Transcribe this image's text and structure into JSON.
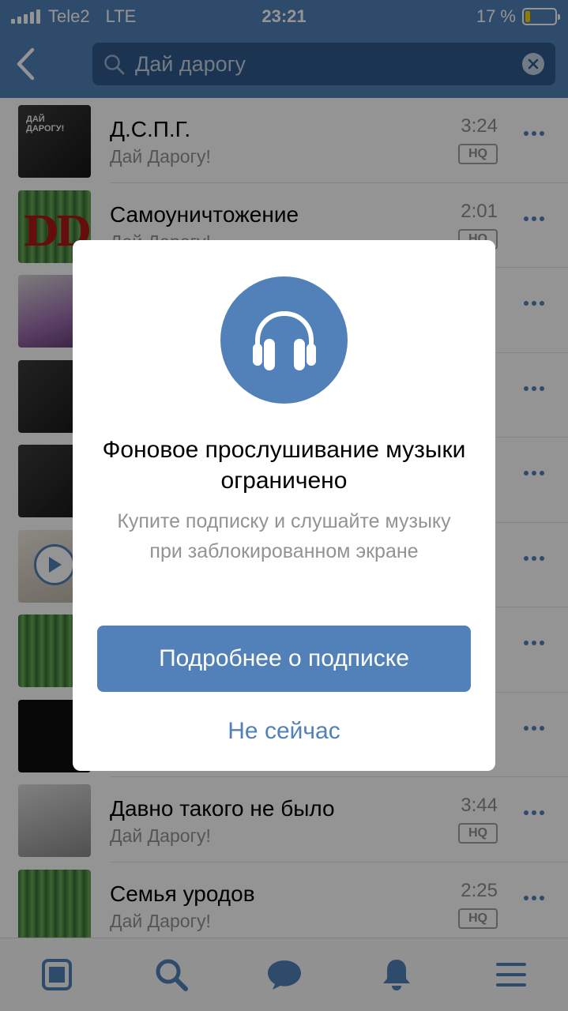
{
  "status_bar": {
    "carrier": "Tele2",
    "network": "LTE",
    "time": "23:21",
    "battery": "17 %",
    "battery_level_percent": 17
  },
  "header": {
    "back_icon": "chevron-left-icon",
    "search": {
      "value": "Дай дарогу",
      "icon": "search-icon",
      "clear_icon": "clear-icon"
    }
  },
  "tracks": [
    {
      "title": "Д.С.П.Г.",
      "artist": "Дай Дарогу!",
      "duration": "3:24",
      "quality": "HQ"
    },
    {
      "title": "Самоуничтожение",
      "artist": "Дай Дарогу!",
      "duration": "2:01",
      "quality": "HQ"
    },
    {
      "title": "",
      "artist": "",
      "duration": "",
      "quality": ""
    },
    {
      "title": "",
      "artist": "",
      "duration": "",
      "quality": ""
    },
    {
      "title": "",
      "artist": "",
      "duration": "",
      "quality": ""
    },
    {
      "title": "",
      "artist": "",
      "duration": "",
      "quality": ""
    },
    {
      "title": "",
      "artist": "",
      "duration": "",
      "quality": ""
    },
    {
      "title": "",
      "artist": "",
      "duration": "",
      "quality": ""
    },
    {
      "title": "Давно такого не было",
      "artist": "Дай Дарогу!",
      "duration": "3:44",
      "quality": "HQ"
    },
    {
      "title": "Семья уродов",
      "artist": "Дай Дарогу!",
      "duration": "2:25",
      "quality": "HQ"
    }
  ],
  "cover_art": {
    "dd_text": "DD",
    "logo_text": "ДАЙ ДАРОГУ!"
  },
  "modal": {
    "icon": "headphones-icon",
    "title": "Фоновое прослушивание музыки ограничено",
    "description": "Купите подписку и слушайте музыку при заблокированном экране",
    "primary_button": "Подробнее о подписке",
    "secondary_button": "Не сейчас"
  },
  "tab_bar": {
    "tabs": [
      "news-icon",
      "search-icon",
      "messages-icon",
      "notifications-icon",
      "menu-icon"
    ]
  },
  "colors": {
    "accent": "#5181b8",
    "battery_low": "#ffd400"
  }
}
